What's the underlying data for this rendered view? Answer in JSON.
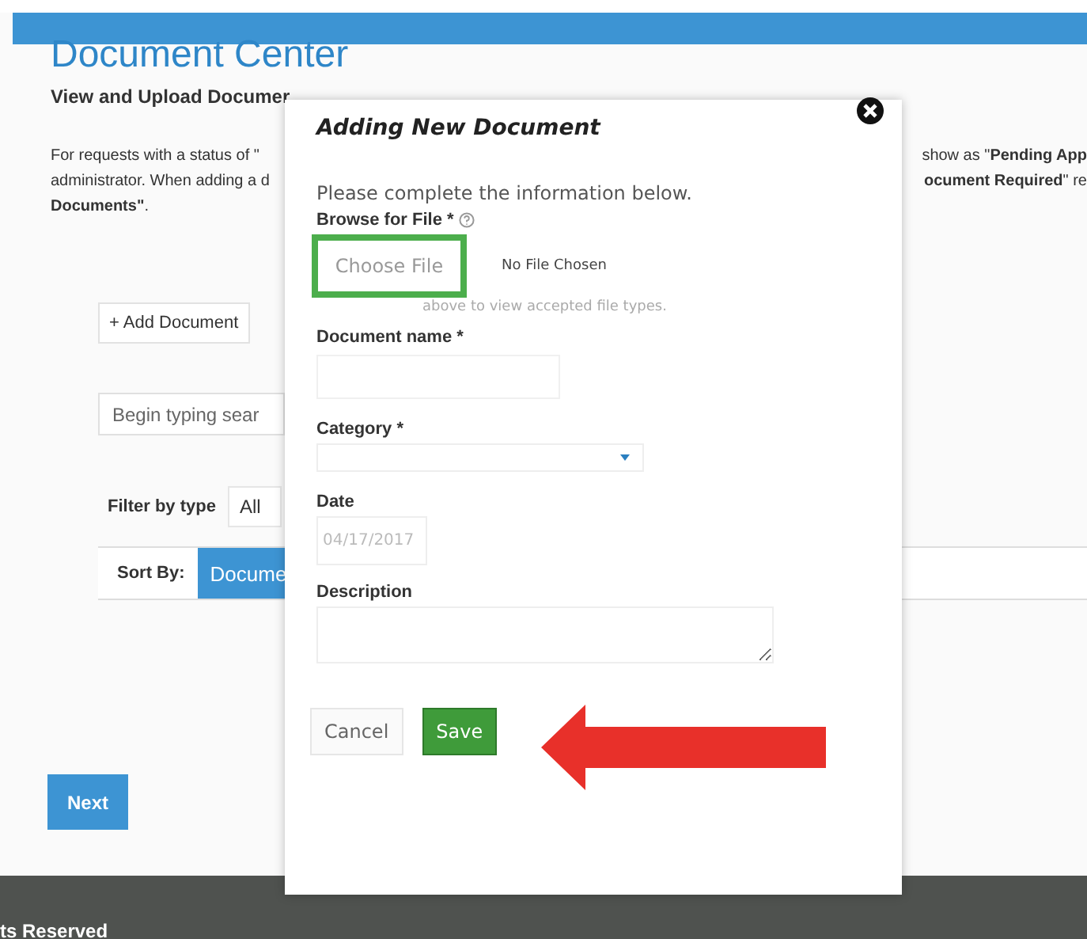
{
  "page": {
    "title": "Document Center",
    "subtitle": "View and Upload Documer",
    "intro": [
      {
        "left": "For requests with a status of \"",
        "right": "show as \"**Pending App**"
      },
      {
        "left": "administrator. When adding a d",
        "right": "**ocument Required**\" re"
      },
      {
        "left": "**Documents\"**."
      }
    ],
    "add_button": "+  Add Document",
    "search": {
      "placeholder": "Begin typing sear"
    },
    "filter": {
      "label": "Filter by type",
      "value": "All"
    },
    "sort": {
      "label": "Sort By:",
      "options": [
        {
          "label": "Docume",
          "selected": true
        }
      ]
    },
    "next_button": "Next",
    "footer": "ts Reserved"
  },
  "modal": {
    "title": "Adding New Document",
    "intro": "Please complete the information below.",
    "fields": [
      {
        "kind": "file",
        "label": "Browse for File *",
        "button": "Choose File",
        "status": "No File Chosen",
        "help": "above to view accepted file types.",
        "highlighted": true
      },
      {
        "kind": "text",
        "label": "Document name *"
      },
      {
        "kind": "select",
        "label": "Category *"
      },
      {
        "kind": "date",
        "label": "Date",
        "value": "04/17/2017",
        "disabled": true
      },
      {
        "kind": "textarea",
        "label": "Description"
      }
    ],
    "buttons": [
      {
        "label": "Cancel",
        "kind": "secondary"
      },
      {
        "label": "Save",
        "kind": "primary"
      }
    ]
  }
}
